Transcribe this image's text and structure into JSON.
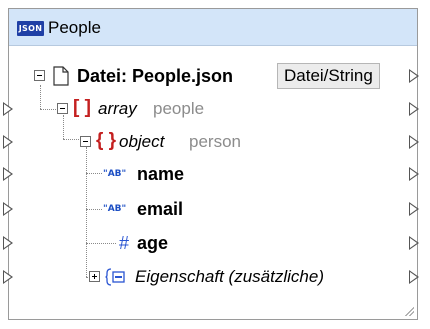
{
  "component": {
    "badge": "JSON",
    "title": "People"
  },
  "tree": {
    "file_label": "Datei: People.json",
    "file_button": "Datei/String",
    "array_bracket": "[ ]",
    "array_type": "array",
    "array_name": "people",
    "object_brace": "{ }",
    "object_type": "object",
    "object_name": "person",
    "name_type": "\"AB\"",
    "name_label": "name",
    "email_type": "\"AB\"",
    "email_label": "email",
    "age_type": "#",
    "age_label": "age",
    "extra_label": "Eigenschaft (zusätzliche)"
  },
  "icons": {
    "file": "document-icon",
    "extra": "additional-property-icon"
  },
  "colors": {
    "titlebar": "#d3e5f9",
    "badge": "#1f3fa6",
    "array_bracket": "#c42020",
    "type_blue": "#2a55d2"
  }
}
